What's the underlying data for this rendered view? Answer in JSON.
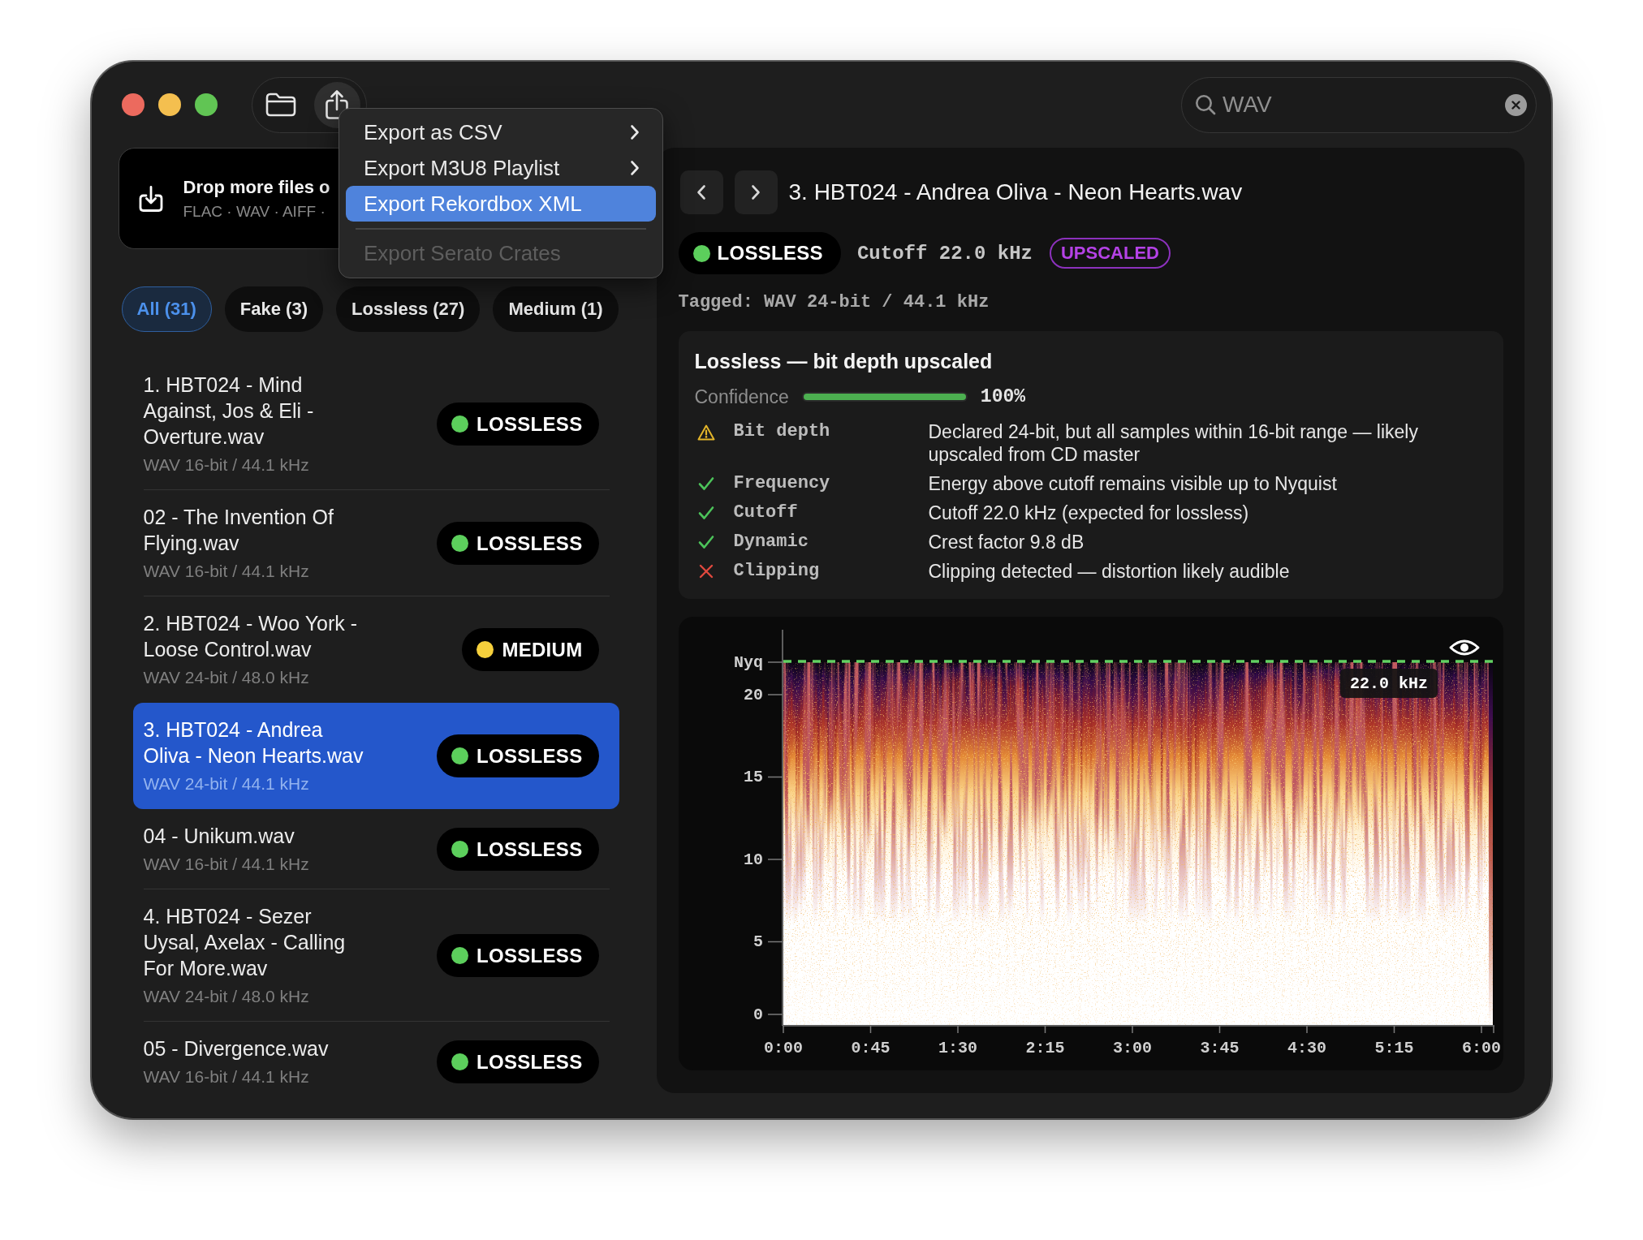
{
  "toolbar": {
    "buttons": [
      {
        "kind": "folder",
        "pressed": false
      },
      {
        "kind": "share",
        "pressed": true
      }
    ]
  },
  "search": {
    "value": "WAV"
  },
  "export_menu": {
    "groups": [
      [
        {
          "label": "Export as CSV",
          "submenu": true,
          "selected": false,
          "disabled": false
        },
        {
          "label": "Export M3U8 Playlist",
          "submenu": true,
          "selected": false,
          "disabled": false
        },
        {
          "label": "Export Rekordbox XML",
          "submenu": false,
          "selected": true,
          "disabled": false
        }
      ],
      [
        {
          "label": "Export Serato Crates",
          "submenu": false,
          "selected": false,
          "disabled": true
        }
      ]
    ]
  },
  "drop_zone": {
    "title": "Drop more files o",
    "formats": "FLAC · WAV · AIFF ·"
  },
  "filters": [
    {
      "label": "All (31)",
      "selected": true
    },
    {
      "label": "Fake (3)",
      "selected": false
    },
    {
      "label": "Lossless (27)",
      "selected": false
    },
    {
      "label": "Medium (1)",
      "selected": false
    }
  ],
  "files": [
    {
      "title": "1. HBT024 - Mind Against, Jos & Eli - Overture.wav",
      "format": "WAV 16-bit / 44.1 kHz",
      "verdict": "LOSSLESS",
      "color": "#5ccf5c",
      "selected": false
    },
    {
      "title": "02 - The Invention Of Flying.wav",
      "format": "WAV 16-bit / 44.1 kHz",
      "verdict": "LOSSLESS",
      "color": "#5ccf5c",
      "selected": false
    },
    {
      "title": "2. HBT024 - Woo York - Loose Control.wav",
      "format": "WAV 24-bit / 48.0 kHz",
      "verdict": "MEDIUM",
      "color": "#f6d03c",
      "selected": false
    },
    {
      "title": "3. HBT024 - Andrea Oliva - Neon Hearts.wav",
      "format": "WAV 24-bit / 44.1 kHz",
      "verdict": "LOSSLESS",
      "color": "#5ccf5c",
      "selected": true
    },
    {
      "title": "04 - Unikum.wav",
      "format": "WAV 16-bit / 44.1 kHz",
      "verdict": "LOSSLESS",
      "color": "#5ccf5c",
      "selected": false
    },
    {
      "title": "4. HBT024 - Sezer Uysal, Axelax - Calling For More.wav",
      "format": "WAV 24-bit / 48.0 kHz",
      "verdict": "LOSSLESS",
      "color": "#5ccf5c",
      "selected": false
    },
    {
      "title": "05 - Divergence.wav",
      "format": "WAV 16-bit / 44.1 kHz",
      "verdict": "LOSSLESS",
      "color": "#5ccf5c",
      "selected": false
    }
  ],
  "detail": {
    "title": "3. HBT024 - Andrea Oliva - Neon Hearts.wav",
    "verdict": {
      "label": "LOSSLESS",
      "color": "#5ccf5c"
    },
    "cutoff": "Cutoff 22.0 kHz",
    "flag": "UPSCALED",
    "tagged": "Tagged: WAV 24-bit / 44.1 kHz",
    "analysis": {
      "title": "Lossless — bit depth upscaled",
      "confidence_label": "Confidence",
      "confidence": {
        "level": 1
      },
      "confidence_value": "100%",
      "checks": [
        {
          "kind": "warning",
          "name": "Bit depth",
          "detail": "Declared 24-bit, but all samples within 16-bit range — likely upscaled from CD master"
        },
        {
          "kind": "pass",
          "name": "Frequency",
          "detail": "Energy above cutoff remains visible up to Nyquist"
        },
        {
          "kind": "pass",
          "name": "Cutoff",
          "detail": "Cutoff 22.0 kHz (expected for lossless)"
        },
        {
          "kind": "pass",
          "name": "Dynamic",
          "detail": "Crest factor 9.8 dB"
        },
        {
          "kind": "fail",
          "name": "Clipping",
          "detail": "Clipping detected — distortion likely audible"
        }
      ]
    },
    "spectrogram": {
      "y_labels": [
        "Nyq",
        "20",
        "15",
        "10",
        "5",
        "0"
      ],
      "x_labels": [
        "0:00",
        "0:45",
        "1:30",
        "2:15",
        "3:00",
        "3:45",
        "4:30",
        "5:15",
        "6:00"
      ],
      "cutoff_label": "22.0 kHz"
    }
  }
}
